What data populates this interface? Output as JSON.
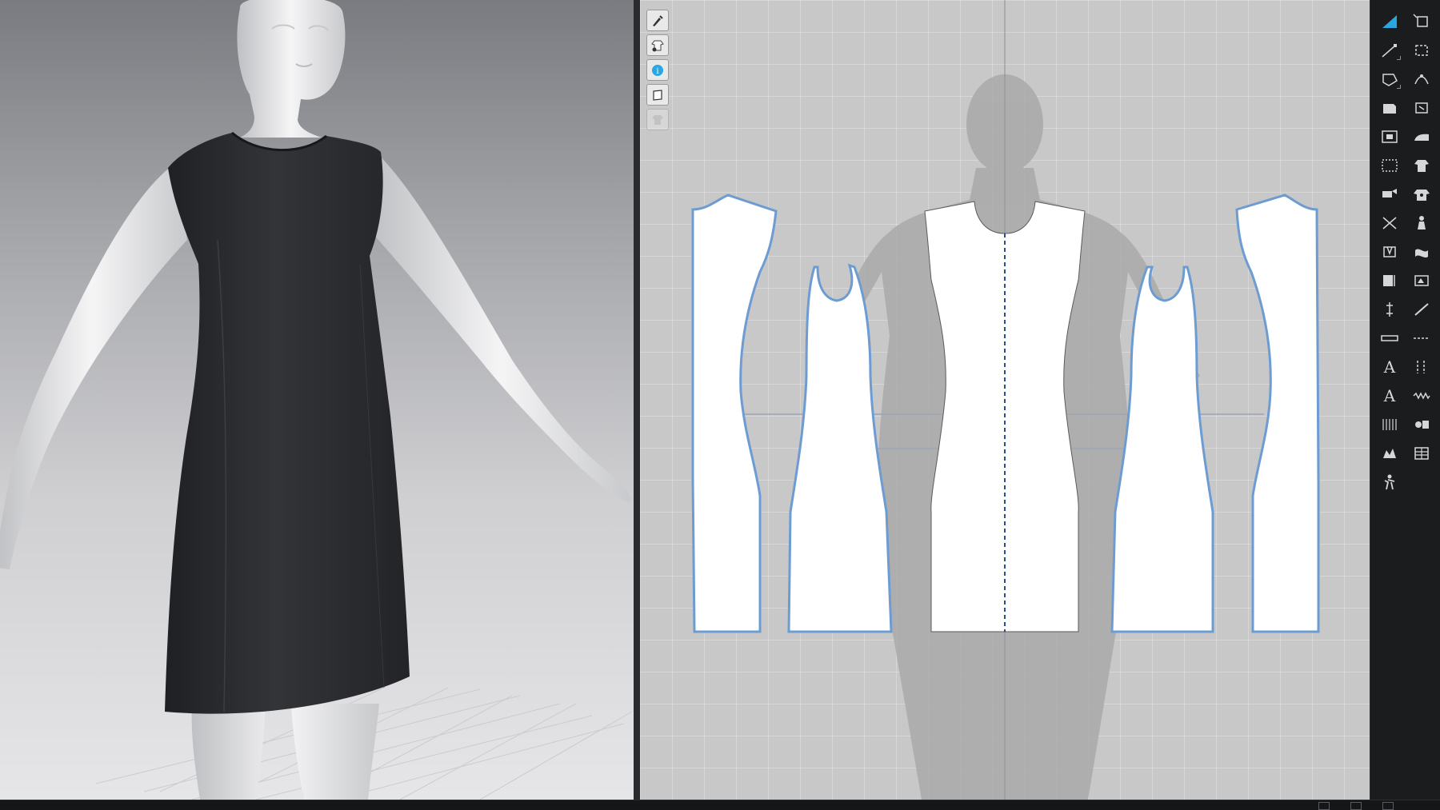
{
  "app": {
    "accent": "#2aa6e0",
    "seam_color": "#6d9cd2",
    "fabric_color": "#2b2c2f"
  },
  "viewport3d": {
    "object": "avatar-in-sleeveless-dress"
  },
  "pattern_window": {
    "tools": [
      {
        "name": "edit-brush-icon"
      },
      {
        "name": "show-garment-icon"
      },
      {
        "name": "info-icon"
      },
      {
        "name": "sheet-icon"
      },
      {
        "name": "avatar-fade-icon"
      }
    ],
    "pieces": [
      {
        "name": "back-side-panel-left"
      },
      {
        "name": "back-panel-left"
      },
      {
        "name": "front-panel"
      },
      {
        "name": "back-panel-right"
      },
      {
        "name": "back-side-panel-right"
      }
    ]
  },
  "toolbar_right": {
    "tools": [
      {
        "name": "select-icon",
        "active": true
      },
      {
        "name": "transform-icon"
      },
      {
        "name": "edit-point-icon"
      },
      {
        "name": "sew-icon"
      },
      {
        "name": "polygon-icon"
      },
      {
        "name": "tack-icon"
      },
      {
        "name": "rectangle-icon"
      },
      {
        "name": "fold-icon"
      },
      {
        "name": "internal-polygon-icon"
      },
      {
        "name": "iron-icon"
      },
      {
        "name": "texture-icon"
      },
      {
        "name": "garment-icon"
      },
      {
        "name": "pin-icon"
      },
      {
        "name": "shirt-icon"
      },
      {
        "name": "cut-icon"
      },
      {
        "name": "avatar-arrange-icon"
      },
      {
        "name": "dart-icon"
      },
      {
        "name": "fabric-icon"
      },
      {
        "name": "zipper-icon"
      },
      {
        "name": "pattern-fill-icon"
      },
      {
        "name": "measure-icon"
      },
      {
        "name": "line-icon"
      },
      {
        "name": "ruler-icon"
      },
      {
        "name": "segment-icon"
      },
      {
        "name": "text-label-icon",
        "label": "A"
      },
      {
        "name": "topstitch-icon"
      },
      {
        "name": "text-tool-icon",
        "label": "A"
      },
      {
        "name": "zigzag-icon"
      },
      {
        "name": "grading-icon"
      },
      {
        "name": "trim-icon"
      },
      {
        "name": "sync-icon"
      },
      {
        "name": "button-icon"
      },
      {
        "name": "avatar-pose-icon"
      }
    ]
  }
}
